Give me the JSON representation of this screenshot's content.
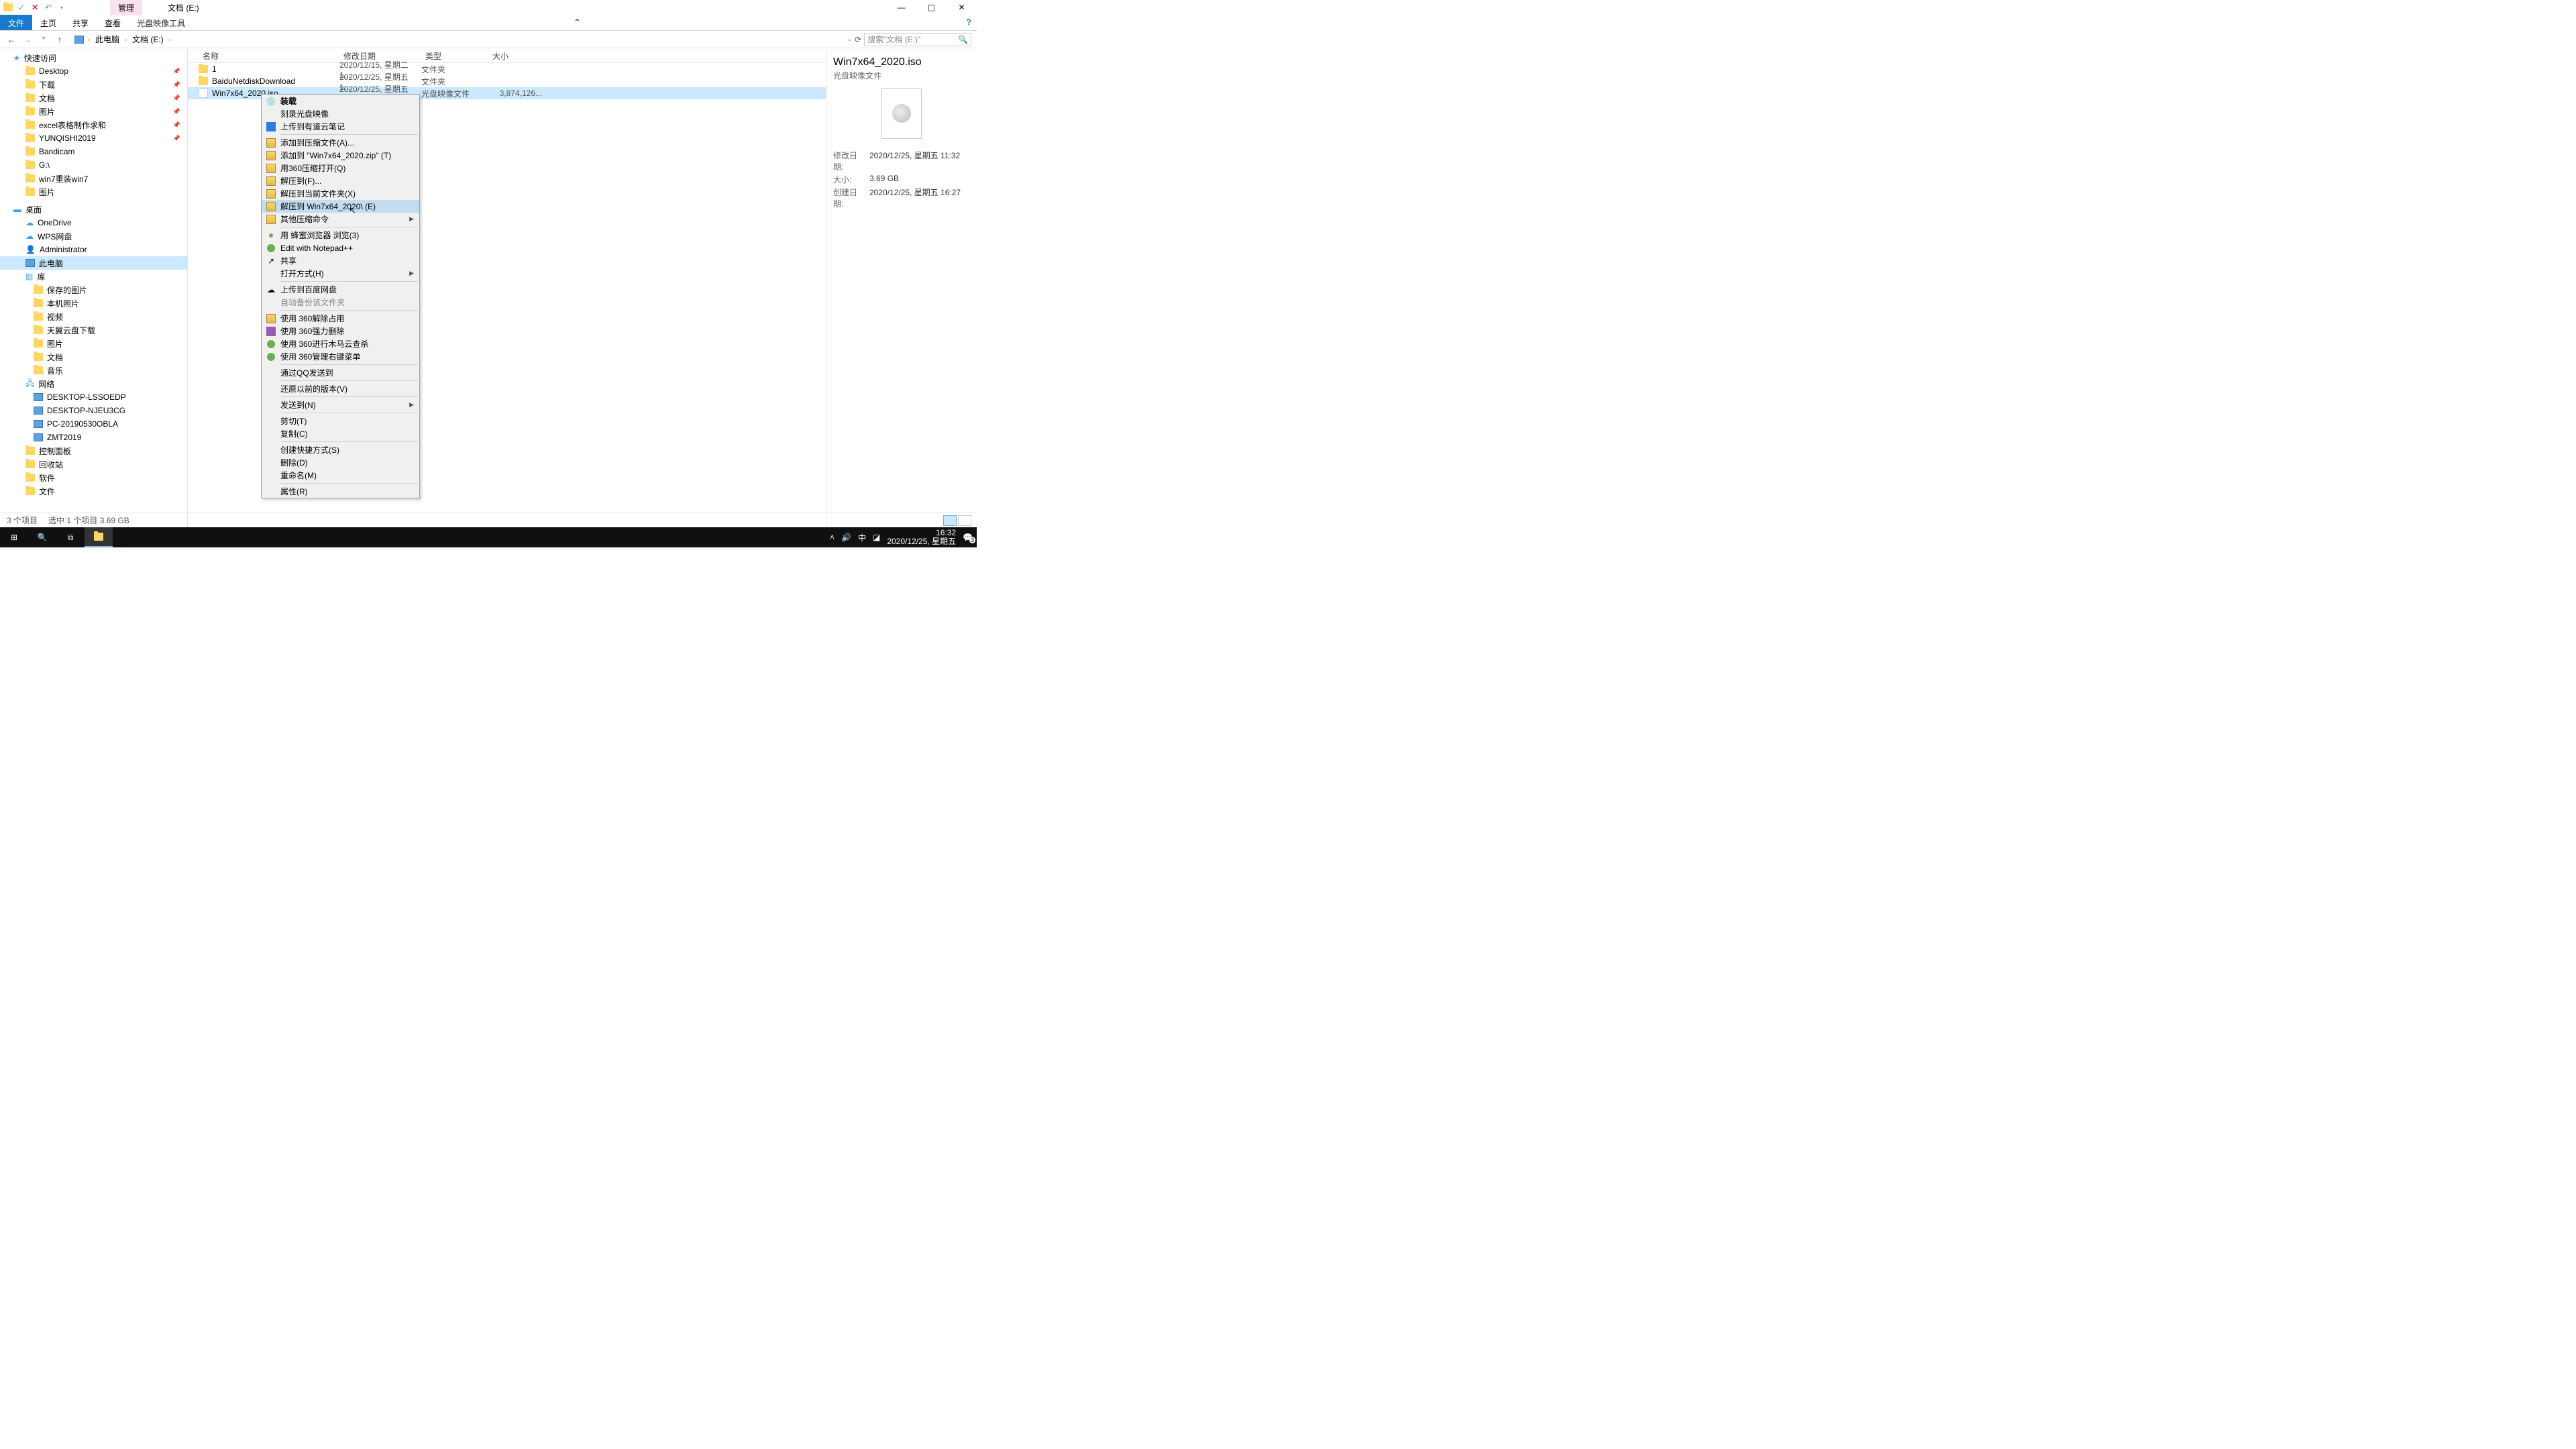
{
  "window": {
    "contextual_tab": "管理",
    "title": "文档 (E:)",
    "ribbon_tabs": [
      "文件",
      "主页",
      "共享",
      "查看",
      "光盘映像工具"
    ]
  },
  "address": {
    "crumbs": [
      "此电脑",
      "文档 (E:)"
    ],
    "search_placeholder": "搜索\"文档 (E:)\""
  },
  "nav": {
    "quick_access": "快速访问",
    "quick_items": [
      {
        "label": "Desktop",
        "pin": true
      },
      {
        "label": "下载",
        "pin": true
      },
      {
        "label": "文档",
        "pin": true
      },
      {
        "label": "图片",
        "pin": true
      },
      {
        "label": "excel表格制作求和",
        "pin": true
      },
      {
        "label": "YUNQISHI2019",
        "pin": true
      },
      {
        "label": "Bandicam",
        "pin": false
      },
      {
        "label": "G:\\",
        "pin": false
      },
      {
        "label": "win7重装win7",
        "pin": false
      },
      {
        "label": "图片",
        "pin": false
      }
    ],
    "desktop": "桌面",
    "desktop_items": [
      "OneDrive",
      "WPS网盘",
      "Administrator",
      "此电脑",
      "库"
    ],
    "lib_items": [
      "保存的图片",
      "本机照片",
      "视频",
      "天翼云盘下载",
      "图片",
      "文档",
      "音乐"
    ],
    "network": "网络",
    "network_items": [
      "DESKTOP-LSSOEDP",
      "DESKTOP-NJEU3CG",
      "PC-20190530OBLA",
      "ZMT2019"
    ],
    "others": [
      "控制面板",
      "回收站",
      "软件",
      "文件"
    ]
  },
  "columns": {
    "name": "名称",
    "date": "修改日期",
    "type": "类型",
    "size": "大小"
  },
  "rows": [
    {
      "name": "1",
      "date": "2020/12/15, 星期二 1...",
      "type": "文件夹",
      "size": "",
      "sel": false,
      "icon": "folder"
    },
    {
      "name": "BaiduNetdiskDownload",
      "date": "2020/12/25, 星期五 1...",
      "type": "文件夹",
      "size": "",
      "sel": false,
      "icon": "folder"
    },
    {
      "name": "Win7x64_2020.iso",
      "date": "2020/12/25, 星期五 1...",
      "type": "光盘映像文件",
      "size": "3,874,126...",
      "sel": true,
      "icon": "iso"
    }
  ],
  "context_menu": [
    {
      "label": "装载",
      "bold": true,
      "icon": "disc"
    },
    {
      "label": "刻录光盘映像"
    },
    {
      "label": "上传到有道云笔记",
      "icon": "blue"
    },
    {
      "sep": true
    },
    {
      "label": "添加到压缩文件(A)...",
      "icon": "arch"
    },
    {
      "label": "添加到 \"Win7x64_2020.zip\" (T)",
      "icon": "arch"
    },
    {
      "label": "用360压缩打开(Q)",
      "icon": "arch"
    },
    {
      "label": "解压到(F)...",
      "icon": "arch"
    },
    {
      "label": "解压到当前文件夹(X)",
      "icon": "arch"
    },
    {
      "label": "解压到 Win7x64_2020\\ (E)",
      "icon": "arch",
      "hover": true
    },
    {
      "label": "其他压缩命令",
      "icon": "arch",
      "submenu": true
    },
    {
      "sep": true
    },
    {
      "label": "用 蜂蜜浏览器 浏览(3)",
      "icon": "green-dot"
    },
    {
      "label": "Edit with Notepad++",
      "icon": "green"
    },
    {
      "label": "共享",
      "icon": "share"
    },
    {
      "label": "打开方式(H)",
      "submenu": true
    },
    {
      "sep": true
    },
    {
      "label": "上传到百度网盘",
      "icon": "cloud"
    },
    {
      "label": "自动备份该文件夹",
      "disabled": true
    },
    {
      "sep": true
    },
    {
      "label": "使用 360解除占用",
      "icon": "arch"
    },
    {
      "label": "使用 360强力删除",
      "icon": "purple"
    },
    {
      "label": "使用 360进行木马云查杀",
      "icon": "green"
    },
    {
      "label": "使用 360管理右键菜单",
      "icon": "green"
    },
    {
      "sep": true
    },
    {
      "label": "通过QQ发送到"
    },
    {
      "sep": true
    },
    {
      "label": "还原以前的版本(V)"
    },
    {
      "sep": true
    },
    {
      "label": "发送到(N)",
      "submenu": true
    },
    {
      "sep": true
    },
    {
      "label": "剪切(T)"
    },
    {
      "label": "复制(C)"
    },
    {
      "sep": true
    },
    {
      "label": "创建快捷方式(S)"
    },
    {
      "label": "删除(D)"
    },
    {
      "label": "重命名(M)"
    },
    {
      "sep": true
    },
    {
      "label": "属性(R)"
    }
  ],
  "preview": {
    "title": "Win7x64_2020.iso",
    "subtitle": "光盘映像文件",
    "meta": [
      {
        "lbl": "修改日期:",
        "val": "2020/12/25, 星期五 11:32"
      },
      {
        "lbl": "大小:",
        "val": "3.69 GB"
      },
      {
        "lbl": "创建日期:",
        "val": "2020/12/25, 星期五 16:27"
      }
    ]
  },
  "status": {
    "items": "3 个项目",
    "selection": "选中 1 个项目  3.69 GB"
  },
  "taskbar": {
    "ime": "中",
    "time": "16:32",
    "date": "2020/12/25, 星期五",
    "notif_count": "3"
  }
}
